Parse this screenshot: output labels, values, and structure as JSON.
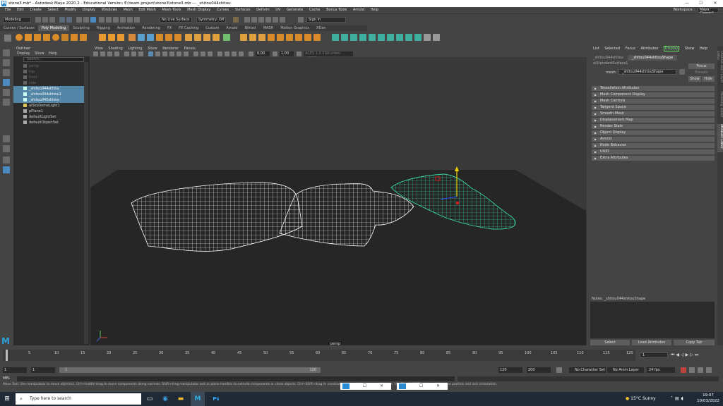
{
  "window": {
    "tab_title": "stone3.mb* - Autode...",
    "tab_title2": "_shitou044shitou...",
    "title": "stone3.mb* - Autodesk Maya 2020.2 - Educational Version: E:\\team project\\stone3\\stone3.mb  ---  _shitou044shitou",
    "minimize": "—",
    "maximize": "☐",
    "close": "✕"
  },
  "menubar": {
    "items": [
      "File",
      "Edit",
      "Create",
      "Select",
      "Modify",
      "Display",
      "Windows",
      "Mesh",
      "Edit Mesh",
      "Mesh Tools",
      "Mesh Display",
      "Curves",
      "Surfaces",
      "Deform",
      "UV",
      "Generate",
      "Cache",
      "Bonus Tools",
      "Arnold",
      "Help"
    ],
    "workspace_label": "Workspace :",
    "workspace_value": "Maya Classic*"
  },
  "statusline": {
    "mode": "Modeling",
    "live_surface": "No Live Surface",
    "symmetry": "Symmetry: Off",
    "signin": "Sign In"
  },
  "shelf_tabs": [
    "Curves / Surfaces",
    "Poly Modeling",
    "Sculpting",
    "Rigging",
    "Animation",
    "Rendering",
    "FX",
    "FX Caching",
    "Custom",
    "Arnold",
    "Bifrost",
    "MASH",
    "Motion Graphics",
    "XGen"
  ],
  "shelf_active": "Poly Modeling",
  "outliner": {
    "title": "Outliner",
    "menu": [
      "Display",
      "Show",
      "Help"
    ],
    "search_placeholder": "Search...",
    "items": [
      {
        "label": "persp",
        "state": "dim"
      },
      {
        "label": "top",
        "state": "dim"
      },
      {
        "label": "front",
        "state": "dim"
      },
      {
        "label": "side",
        "state": "dim"
      },
      {
        "label": "_shitou044shitou",
        "state": "hl"
      },
      {
        "label": "_shitou044shitou1",
        "state": "hl"
      },
      {
        "label": "_shitou045shitou",
        "state": "hl"
      },
      {
        "label": "aiSkyDomeLight1",
        "state": "normal"
      },
      {
        "label": "pPlane1",
        "state": "normal"
      },
      {
        "label": "defaultLightSet",
        "state": "normal"
      },
      {
        "label": "defaultObjectSet",
        "state": "normal"
      }
    ]
  },
  "viewport": {
    "menu": [
      "View",
      "Shading",
      "Lighting",
      "Show",
      "Renderer",
      "Panels"
    ],
    "value_a": "0.00",
    "value_b": "1.00",
    "colorspace": "ACES 1.0 SDR-video (sRGB)",
    "camera_label": "persp"
  },
  "attribute_editor": {
    "menu": [
      "List",
      "Selected",
      "Focus",
      "Attributes",
      "Display",
      "Show",
      "Help"
    ],
    "tabs": [
      "_shitou044shitou",
      "_shitou044shitouShape",
      "aiStandardSurface1"
    ],
    "active_tab": "_shitou044shitouShape",
    "mesh_label": "mesh:",
    "mesh_value": "_shitou044shitouShape",
    "focus": "Focus",
    "presets": "Presets",
    "show": "Show",
    "hide": "Hide",
    "sections": [
      "Tessellation Attributes",
      "Mesh Component Display",
      "Mesh Controls",
      "Tangent Space",
      "Smooth Mesh",
      "Displacement Map",
      "Render Stats",
      "Object Display",
      "Arnold",
      "Node Behavior",
      "UUID",
      "Extra Attributes"
    ],
    "notes_label": "Notes: _shitou044shitouShape",
    "buttons": [
      "Select",
      "Load Attributes",
      "Copy Tab"
    ],
    "side_tabs": [
      "Channel Box / Layer Editor",
      "Modeling Toolkit",
      "Attribute Editor"
    ]
  },
  "timeline": {
    "ticks": [
      "5",
      "10",
      "15",
      "20",
      "25",
      "30",
      "35",
      "40",
      "45",
      "50",
      "55",
      "60",
      "65",
      "70",
      "75",
      "80",
      "85",
      "90",
      "95",
      "100",
      "105",
      "110",
      "115",
      "120"
    ],
    "current_frame": "1"
  },
  "range": {
    "start": "1",
    "inner_start": "1",
    "slider_start": "1",
    "slider_end": "120",
    "inner_end": "120",
    "end": "200",
    "char_set": "No Character Set",
    "anim_layer": "No Anim Layer",
    "fps": "24 fps"
  },
  "mel_label": "MEL",
  "help_line": "Move Tool: Use manipulator to move object(s). Ctrl+middle-drag to move components along normals. Shift+drag manipulator axis or plane handles to extrude components or clone objects. Ctrl+Shift+drag to constrain movement to a connected edge. Use D or INSERT to change the pivot position and axis orientation.",
  "taskbar": {
    "search": "Type here to search",
    "weather": "15°C  Sunny",
    "time": "19:07",
    "date": "10/03/2022"
  },
  "colors": {
    "highlight": "#5285a6",
    "wire_selected": "#3bd9a4",
    "wire_normal": "#ffffff",
    "panel": "#444444",
    "viewport": "#393939"
  }
}
